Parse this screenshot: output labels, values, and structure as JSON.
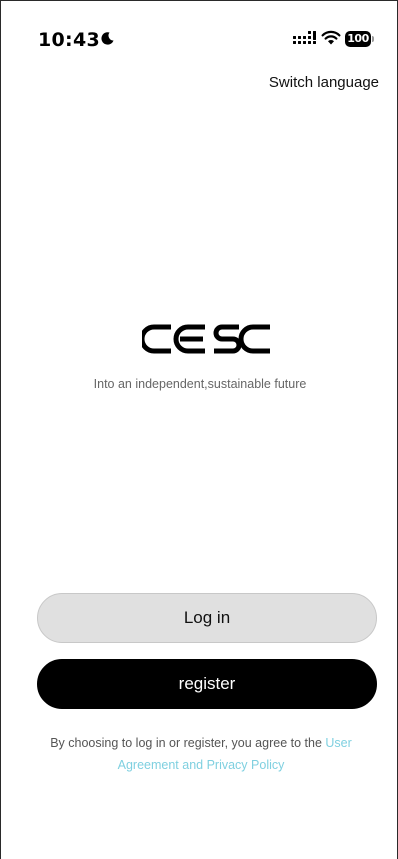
{
  "status_bar": {
    "time": "10:43",
    "battery_level": "100",
    "icons": [
      "moon-icon",
      "signal-icon",
      "wifi-icon",
      "battery-icon"
    ]
  },
  "header": {
    "switch_language": "Switch language"
  },
  "brand": {
    "logo_text": "CESC",
    "tagline": "Into an independent,sustainable future"
  },
  "actions": {
    "login_label": "Log in",
    "register_label": "register"
  },
  "agreement": {
    "prefix": "By choosing to log in or register, you agree to the ",
    "link_text": "User Agreement and Privacy Policy"
  },
  "colors": {
    "link": "#7fd0e0",
    "login_bg": "#e0e0e0",
    "register_bg": "#000000"
  }
}
